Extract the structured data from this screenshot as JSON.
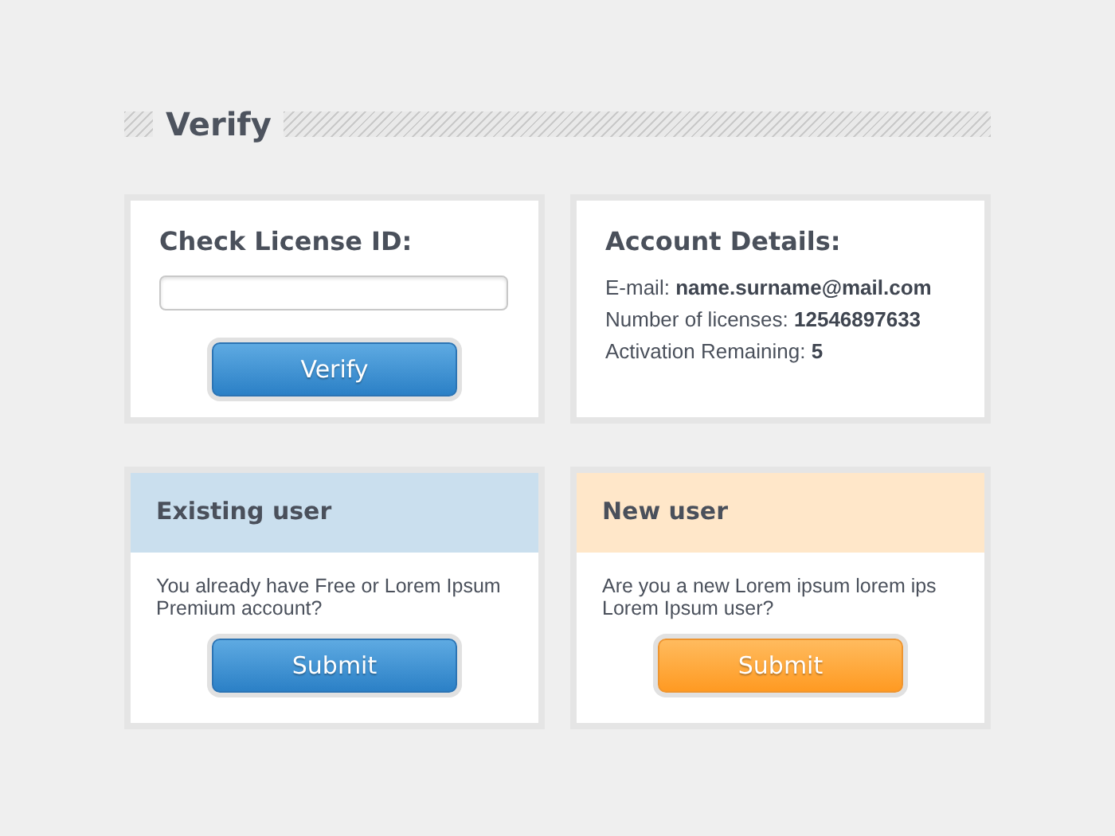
{
  "title": "Verify",
  "license": {
    "heading": "Check License ID:",
    "button": "Verify"
  },
  "account": {
    "heading": "Account Details:",
    "rows": [
      "E-mail: **name.surname@mail.com**",
      "Number of licenses: **12546897633**",
      "Activation Remaining: **5**"
    ]
  },
  "users": [
    {
      "kind": "existing",
      "title": "Existing user",
      "text": "You already have Free or Lorem Ipsum Premium account?",
      "button": "Submit"
    },
    {
      "kind": "new",
      "title": "New user",
      "text": "Are you a new Lorem ipsum lorem ips Lorem Ipsum user?",
      "button": "Submit"
    }
  ]
}
